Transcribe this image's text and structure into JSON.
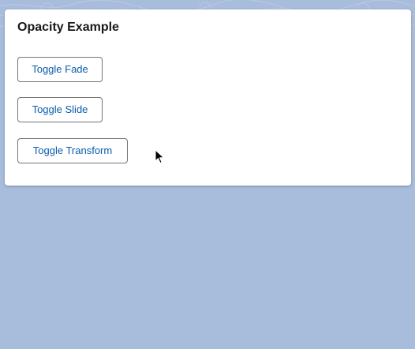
{
  "card": {
    "title": "Opacity Example",
    "buttons": [
      {
        "label": "Toggle Fade"
      },
      {
        "label": "Toggle Slide"
      },
      {
        "label": "Toggle Transform"
      }
    ]
  },
  "colors": {
    "background": "#a8bcdc",
    "card": "#ffffff",
    "title_text": "#181818",
    "button_text": "#0b5cab",
    "button_border": "#747474"
  },
  "icons": {
    "cursor": "mouse-pointer-icon"
  }
}
